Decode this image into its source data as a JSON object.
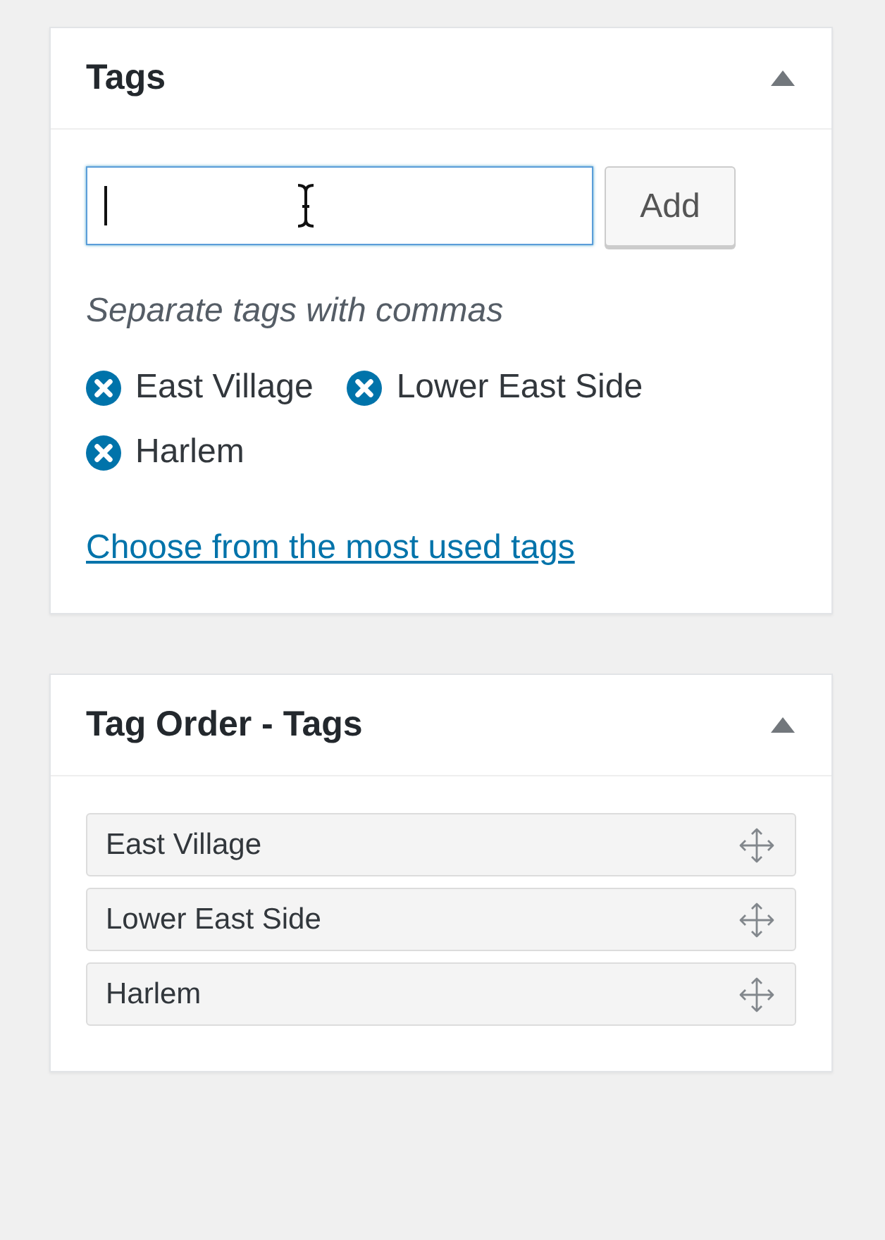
{
  "tags_box": {
    "title": "Tags",
    "expanded": true,
    "input": {
      "focused": true
    },
    "add_button": "Add",
    "hint": "Separate tags with commas",
    "tags": [
      {
        "label": "East Village"
      },
      {
        "label": "Lower East Side"
      },
      {
        "label": "Harlem"
      }
    ],
    "most_used_link": "Choose from the most used tags"
  },
  "tag_order_box": {
    "title": "Tag Order - Tags",
    "expanded": true,
    "items": [
      {
        "label": "East Village"
      },
      {
        "label": "Lower East Side"
      },
      {
        "label": "Harlem"
      }
    ]
  }
}
